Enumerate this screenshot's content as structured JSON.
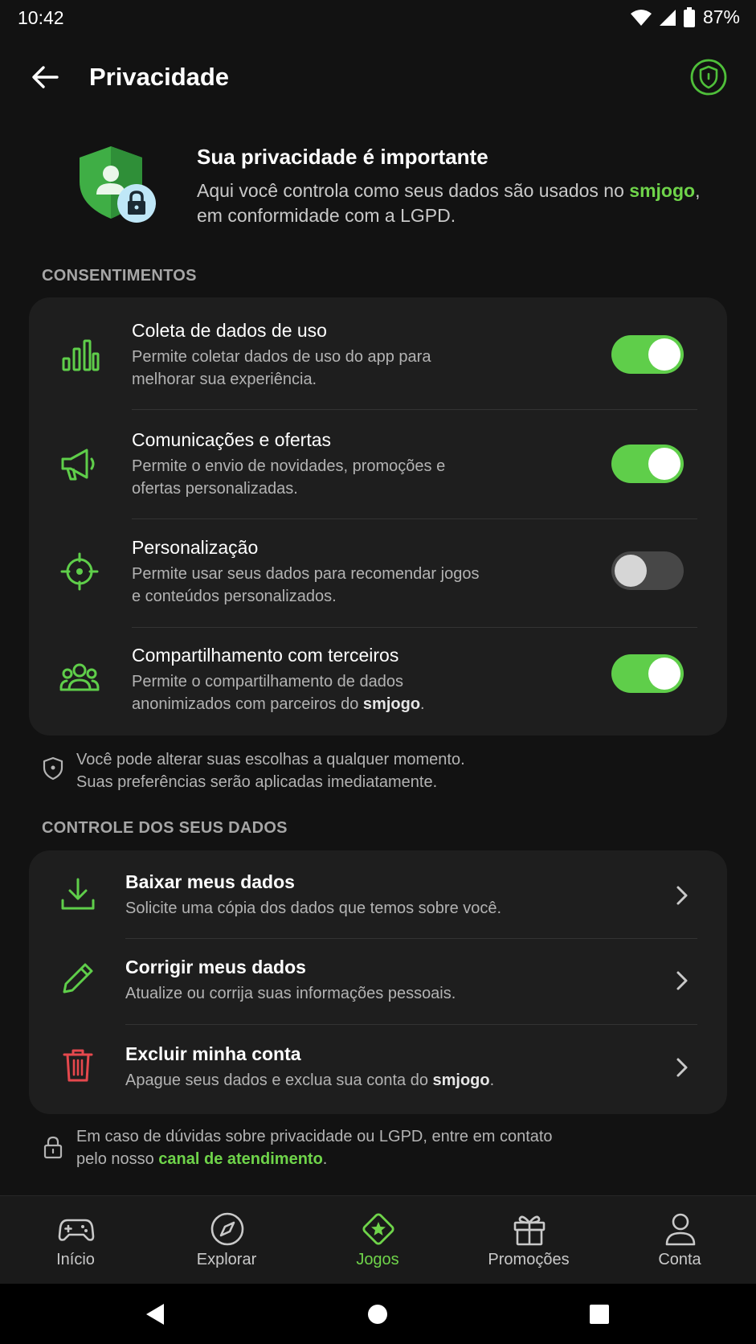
{
  "status_bar": {
    "time": "10:42",
    "battery": "87%"
  },
  "app_bar": {
    "title": "Privacidade"
  },
  "intro": {
    "title": "Sua privacidade é importante",
    "text_before": "Aqui você controla como seus dados são usados no ",
    "brand": "smjogo",
    "text_after": ", em conformidade com a LGPD."
  },
  "consents": {
    "header": "CONSENTIMENTOS",
    "items": [
      {
        "title": "Coleta de dados de uso",
        "desc": "Permite coletar dados de uso do app para melhorar sua experiência.",
        "enabled": true
      },
      {
        "title": "Comunicações e ofertas",
        "desc": "Permite o envio de novidades, promoções e ofertas personalizadas.",
        "enabled": true
      },
      {
        "title": "Personalização",
        "desc": "Permite usar seus dados para recomendar jogos e conteúdos personalizados.",
        "enabled": false
      },
      {
        "title": "Compartilhamento com terceiros",
        "desc_before": "Permite o compartilhamento de dados anonimizados com parceiros do ",
        "desc_brand": "smjogo",
        "desc_after": ".",
        "enabled": true
      }
    ],
    "note_line1": "Você pode alterar suas escolhas a qualquer momento.",
    "note_line2": "Suas preferências serão aplicadas imediatamente."
  },
  "data_control": {
    "header": "CONTROLE DOS SEUS DADOS",
    "items": [
      {
        "title": "Baixar meus dados",
        "desc": "Solicite uma cópia dos dados que temos sobre você."
      },
      {
        "title": "Corrigir meus dados",
        "desc": "Atualize ou corrija suas informações pessoais."
      },
      {
        "title": "Excluir minha conta",
        "desc_before": "Apague seus dados e exclua sua conta do ",
        "desc_brand": "smjogo",
        "desc_after": "."
      }
    ]
  },
  "footer_note": {
    "line1": "Em caso de dúvidas sobre privacidade ou LGPD, entre em contato",
    "line2_before": "pelo nosso ",
    "link": "canal de atendimento",
    "line2_after": "."
  },
  "bottom_nav": {
    "items": [
      {
        "label": "Início",
        "icon": "gamepad-icon"
      },
      {
        "label": "Explorar",
        "icon": "compass-icon"
      },
      {
        "label": "Jogos",
        "icon": "star-diamond-icon",
        "active": true
      },
      {
        "label": "Promoções",
        "icon": "gift-icon"
      },
      {
        "label": "Conta",
        "icon": "user-icon"
      }
    ]
  },
  "colors": {
    "accent": "#6fd44a",
    "toggle_on": "#5fce4a",
    "danger": "#e5484d",
    "background": "#121212",
    "card": "#1e1e1e"
  }
}
